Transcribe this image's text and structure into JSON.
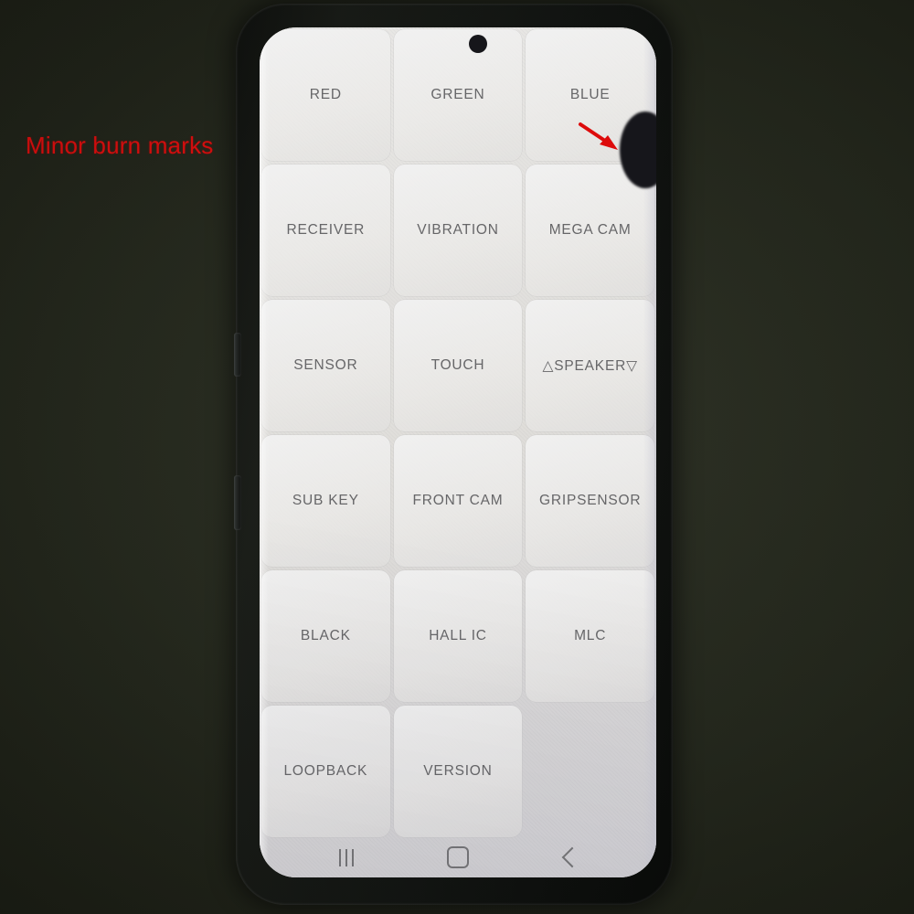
{
  "annotation": {
    "text": "Minor burn marks",
    "color": "#ee0b0b",
    "arrow_icon": "arrow-pointer-icon"
  },
  "device": {
    "body_color": "#101310",
    "screen_background": "#f2f1ee",
    "front_camera_icon": "punch-hole-camera",
    "defect_icon": "screen-burn-blob",
    "side_buttons": [
      "volume-rocker",
      "power-button"
    ]
  },
  "screen": {
    "app": "Factory Test Menu",
    "grid": {
      "columns": 3,
      "rows": 6,
      "cells": [
        {
          "label": "RED",
          "empty": false
        },
        {
          "label": "GREEN",
          "empty": false
        },
        {
          "label": "BLUE",
          "empty": false
        },
        {
          "label": "RECEIVER",
          "empty": false
        },
        {
          "label": "VIBRATION",
          "empty": false
        },
        {
          "label": "MEGA CAM",
          "empty": false
        },
        {
          "label": "SENSOR",
          "empty": false
        },
        {
          "label": "TOUCH",
          "empty": false
        },
        {
          "label": "△SPEAKER▽",
          "empty": false
        },
        {
          "label": "SUB KEY",
          "empty": false
        },
        {
          "label": "FRONT CAM",
          "empty": false
        },
        {
          "label": "GRIPSENSOR",
          "empty": false
        },
        {
          "label": "BLACK",
          "empty": false
        },
        {
          "label": "HALL IC",
          "empty": false
        },
        {
          "label": "MLC",
          "empty": false
        },
        {
          "label": "LOOPBACK",
          "empty": false
        },
        {
          "label": "VERSION",
          "empty": false
        },
        {
          "label": "",
          "empty": true
        }
      ]
    },
    "navbar": {
      "items": [
        {
          "icon": "recents-icon",
          "name": "recents-button"
        },
        {
          "icon": "home-icon",
          "name": "home-button"
        },
        {
          "icon": "back-icon",
          "name": "back-button"
        }
      ]
    }
  }
}
